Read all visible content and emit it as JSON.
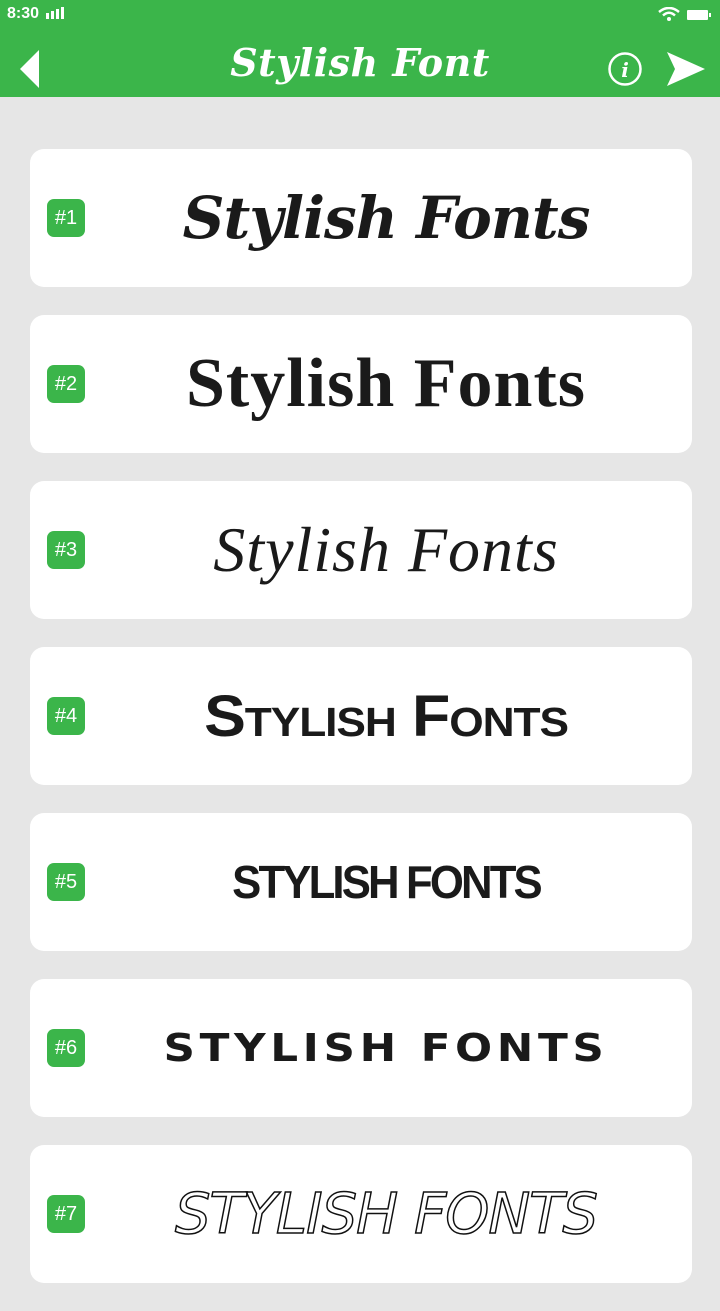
{
  "status_bar": {
    "time": "8:30"
  },
  "header": {
    "title": "Stylish Font",
    "back_icon": "back-arrow-icon",
    "info_icon": "info-icon",
    "share_icon": "send-icon"
  },
  "colors": {
    "accent": "#3bb54a",
    "background": "#e6e6e6",
    "card": "#ffffff",
    "text": "#1a1a1a"
  },
  "fonts": [
    {
      "badge": "#1",
      "sample": "Stylish Fonts"
    },
    {
      "badge": "#2",
      "sample": "Stylish Fonts"
    },
    {
      "badge": "#3",
      "sample": "Stylish Fonts"
    },
    {
      "badge": "#4",
      "sample": "Stylish Fonts"
    },
    {
      "badge": "#5",
      "sample": "STYLISH FONTS"
    },
    {
      "badge": "#6",
      "sample": "STYLISH FONTS"
    },
    {
      "badge": "#7",
      "sample": "STYLISH FONTS"
    }
  ]
}
